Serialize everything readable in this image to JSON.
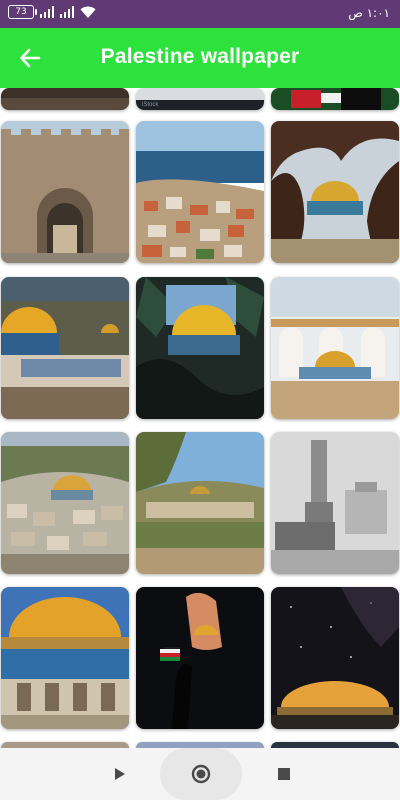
{
  "status_bar": {
    "battery": "73",
    "time": "١:٠١ ص"
  },
  "app_bar": {
    "title": "Palestine wallpaper",
    "back_icon": "arrow-left-icon"
  },
  "wallpapers": [
    {
      "id": "row0-col0",
      "subject": "stone-texture"
    },
    {
      "id": "row0-col1",
      "subject": "istock-watermark",
      "watermark": "iStock"
    },
    {
      "id": "row0-col2",
      "subject": "palestinian-flag"
    },
    {
      "id": "row1-col0",
      "subject": "old-city-gate"
    },
    {
      "id": "row1-col1",
      "subject": "coastal-city"
    },
    {
      "id": "row1-col2",
      "subject": "dome-through-tree"
    },
    {
      "id": "row2-col0",
      "subject": "dome-of-the-rock-view"
    },
    {
      "id": "row2-col1",
      "subject": "dome-framed-by-leaves"
    },
    {
      "id": "row2-col2",
      "subject": "dome-with-arches"
    },
    {
      "id": "row3-col0",
      "subject": "jerusalem-panorama"
    },
    {
      "id": "row3-col1",
      "subject": "landscape-with-dome"
    },
    {
      "id": "row3-col2",
      "subject": "vintage-photo-tower"
    },
    {
      "id": "row4-col0",
      "subject": "dome-close-up"
    },
    {
      "id": "row4-col1",
      "subject": "silhouette-with-flag"
    },
    {
      "id": "row4-col2",
      "subject": "dome-at-night"
    }
  ],
  "nav_bar": {
    "back_icon": "triangle-back-icon",
    "home_icon": "circle-home-icon",
    "recents_icon": "square-recents-icon"
  }
}
